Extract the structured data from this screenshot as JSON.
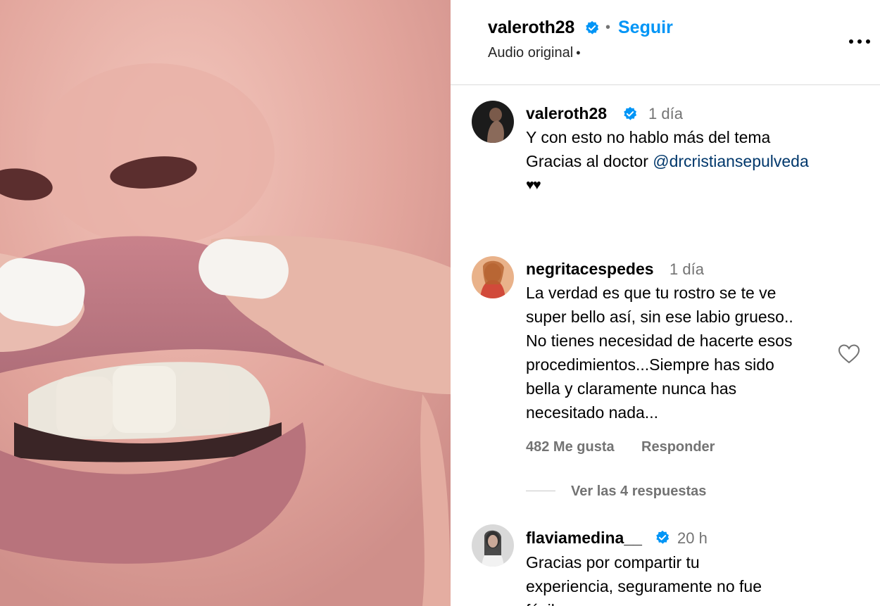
{
  "header": {
    "username": "valeroth28",
    "separator": "•",
    "follow_label": "Seguir",
    "audio_label": "Audio original",
    "audio_dot": "•",
    "more_icon": "more-horizontal-icon"
  },
  "caption": {
    "username": "valeroth28",
    "time": "1 día",
    "line1": "Y con esto no hablo más del tema",
    "line2_prefix": "Gracias al doctor ",
    "mention": "@drcristiansepulveda",
    "emoji": "♥♥"
  },
  "comments": [
    {
      "username": "negritacespedes",
      "time": "1 día",
      "lines": [
        "La verdad es que tu rostro se te ve",
        "super bello así, sin ese labio grueso..",
        "No tienes necesidad de hacerte esos",
        "procedimientos...Siempre has sido",
        "bella y claramente nunca has",
        "necesitado nada..."
      ],
      "likes": "482 Me gusta",
      "reply_label": "Responder",
      "view_replies": "Ver las 4 respuestas"
    },
    {
      "username": "flaviamedina__",
      "time": "20 h",
      "lines": [
        "Gracias por compartir tu",
        "experiencia, seguramente no fue",
        "fácil"
      ]
    }
  ],
  "colors": {
    "accent": "#0095f6",
    "verified": "#0095f6",
    "mention": "#00376b",
    "muted": "#737373"
  }
}
